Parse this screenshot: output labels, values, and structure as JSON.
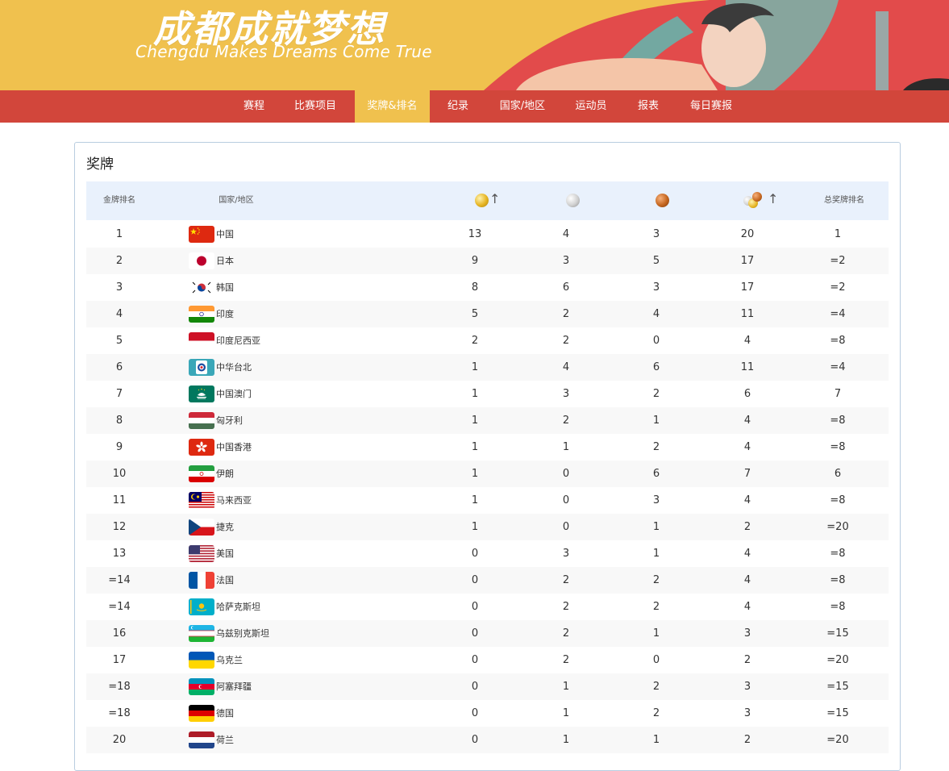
{
  "banner": {
    "title": "成都成就梦想",
    "subtitle": "Chengdu Makes Dreams Come True"
  },
  "nav": {
    "items": [
      "赛程",
      "比赛项目",
      "奖牌&排名",
      "纪录",
      "国家/地区",
      "运动员",
      "报表",
      "每日赛报"
    ],
    "active_index": 2
  },
  "panel": {
    "title": "奖牌"
  },
  "table": {
    "headers": {
      "rank": "金牌排名",
      "country": "国家/地区",
      "gold_icon": "gold-medal-icon",
      "silver_icon": "silver-medal-icon",
      "bronze_icon": "bronze-medal-icon",
      "total_icon": "total-medals-icon",
      "sort_arrow": "↑",
      "total_rank": "总奖牌排名"
    },
    "rows": [
      {
        "rank": "1",
        "country": "中国",
        "flag": "cn",
        "gold": "13",
        "silver": "4",
        "bronze": "3",
        "total": "20",
        "total_rank": "1"
      },
      {
        "rank": "2",
        "country": "日本",
        "flag": "jp",
        "gold": "9",
        "silver": "3",
        "bronze": "5",
        "total": "17",
        "total_rank": "=2"
      },
      {
        "rank": "3",
        "country": "韩国",
        "flag": "kr",
        "gold": "8",
        "silver": "6",
        "bronze": "3",
        "total": "17",
        "total_rank": "=2"
      },
      {
        "rank": "4",
        "country": "印度",
        "flag": "in",
        "gold": "5",
        "silver": "2",
        "bronze": "4",
        "total": "11",
        "total_rank": "=4"
      },
      {
        "rank": "5",
        "country": "印度尼西亚",
        "flag": "id",
        "gold": "2",
        "silver": "2",
        "bronze": "0",
        "total": "4",
        "total_rank": "=8"
      },
      {
        "rank": "6",
        "country": "中华台北",
        "flag": "tpe",
        "gold": "1",
        "silver": "4",
        "bronze": "6",
        "total": "11",
        "total_rank": "=4"
      },
      {
        "rank": "7",
        "country": "中国澳门",
        "flag": "mo",
        "gold": "1",
        "silver": "3",
        "bronze": "2",
        "total": "6",
        "total_rank": "7"
      },
      {
        "rank": "8",
        "country": "匈牙利",
        "flag": "hu",
        "gold": "1",
        "silver": "2",
        "bronze": "1",
        "total": "4",
        "total_rank": "=8"
      },
      {
        "rank": "9",
        "country": "中国香港",
        "flag": "hk",
        "gold": "1",
        "silver": "1",
        "bronze": "2",
        "total": "4",
        "total_rank": "=8"
      },
      {
        "rank": "10",
        "country": "伊朗",
        "flag": "ir",
        "gold": "1",
        "silver": "0",
        "bronze": "6",
        "total": "7",
        "total_rank": "6"
      },
      {
        "rank": "11",
        "country": "马来西亚",
        "flag": "my",
        "gold": "1",
        "silver": "0",
        "bronze": "3",
        "total": "4",
        "total_rank": "=8"
      },
      {
        "rank": "12",
        "country": "捷克",
        "flag": "cz",
        "gold": "1",
        "silver": "0",
        "bronze": "1",
        "total": "2",
        "total_rank": "=20"
      },
      {
        "rank": "13",
        "country": "美国",
        "flag": "us",
        "gold": "0",
        "silver": "3",
        "bronze": "1",
        "total": "4",
        "total_rank": "=8"
      },
      {
        "rank": "=14",
        "country": "法国",
        "flag": "fr",
        "gold": "0",
        "silver": "2",
        "bronze": "2",
        "total": "4",
        "total_rank": "=8"
      },
      {
        "rank": "=14",
        "country": "哈萨克斯坦",
        "flag": "kz",
        "gold": "0",
        "silver": "2",
        "bronze": "2",
        "total": "4",
        "total_rank": "=8"
      },
      {
        "rank": "16",
        "country": "乌兹别克斯坦",
        "flag": "uz",
        "gold": "0",
        "silver": "2",
        "bronze": "1",
        "total": "3",
        "total_rank": "=15"
      },
      {
        "rank": "17",
        "country": "乌克兰",
        "flag": "ua",
        "gold": "0",
        "silver": "2",
        "bronze": "0",
        "total": "2",
        "total_rank": "=20"
      },
      {
        "rank": "=18",
        "country": "阿塞拜疆",
        "flag": "az",
        "gold": "0",
        "silver": "1",
        "bronze": "2",
        "total": "3",
        "total_rank": "=15"
      },
      {
        "rank": "=18",
        "country": "德国",
        "flag": "de",
        "gold": "0",
        "silver": "1",
        "bronze": "2",
        "total": "3",
        "total_rank": "=15"
      },
      {
        "rank": "20",
        "country": "荷兰",
        "flag": "nl",
        "gold": "0",
        "silver": "1",
        "bronze": "1",
        "total": "2",
        "total_rank": "=20"
      }
    ]
  },
  "colors": {
    "banner_yellow": "#f0c14e",
    "nav_red": "#d2463b",
    "header_blue": "#e9f1fc",
    "gold": "#e6b422",
    "silver": "#c9c9c9",
    "bronze": "#c4651e"
  }
}
